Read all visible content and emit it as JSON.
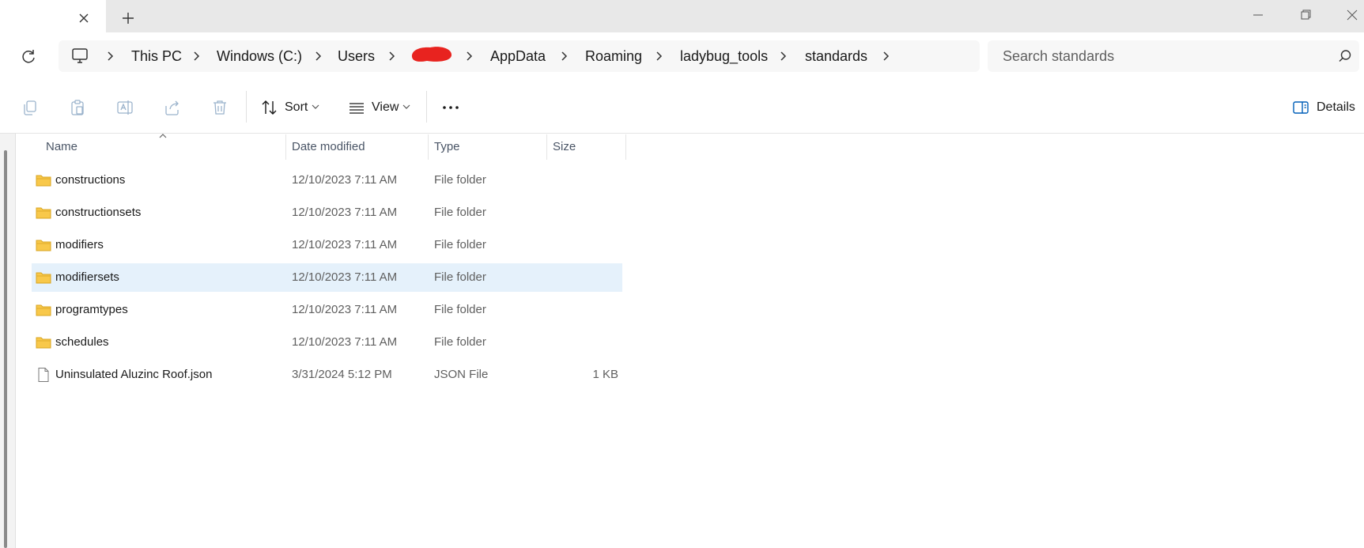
{
  "titlebar": {
    "tab_close_icon": "close-icon",
    "new_tab_icon": "plus-icon",
    "window_buttons": [
      "minimize-icon",
      "restore-icon",
      "close-icon"
    ]
  },
  "address": {
    "breadcrumbs": [
      "This PC",
      "Windows (C:)",
      "Users",
      "",
      "AppData",
      "Roaming",
      "ladybug_tools",
      "standards"
    ],
    "redacted_color": "#e8231f",
    "search_placeholder": "Search standards"
  },
  "toolbar": {
    "sort_label": "Sort",
    "view_label": "View",
    "details_label": "Details"
  },
  "columns": [
    "Name",
    "Date modified",
    "Type",
    "Size"
  ],
  "files": [
    {
      "name": "constructions",
      "date": "12/10/2023 7:11 AM",
      "type": "File folder",
      "size": "",
      "icon": "folder-icon"
    },
    {
      "name": "constructionsets",
      "date": "12/10/2023 7:11 AM",
      "type": "File folder",
      "size": "",
      "icon": "folder-icon"
    },
    {
      "name": "modifiers",
      "date": "12/10/2023 7:11 AM",
      "type": "File folder",
      "size": "",
      "icon": "folder-icon"
    },
    {
      "name": "modifiersets",
      "date": "12/10/2023 7:11 AM",
      "type": "File folder",
      "size": "",
      "icon": "folder-icon",
      "selected": true
    },
    {
      "name": "programtypes",
      "date": "12/10/2023 7:11 AM",
      "type": "File folder",
      "size": "",
      "icon": "folder-icon"
    },
    {
      "name": "schedules",
      "date": "12/10/2023 7:11 AM",
      "type": "File folder",
      "size": "",
      "icon": "folder-icon"
    },
    {
      "name": "Uninsulated Aluzinc Roof.json",
      "date": "3/31/2024 5:12 PM",
      "type": "JSON File",
      "size": "1 KB",
      "icon": "file-icon"
    }
  ],
  "colors": {
    "folder": "#f8c84a",
    "selection": "#e5f1fb",
    "accent": "#005fb8"
  }
}
